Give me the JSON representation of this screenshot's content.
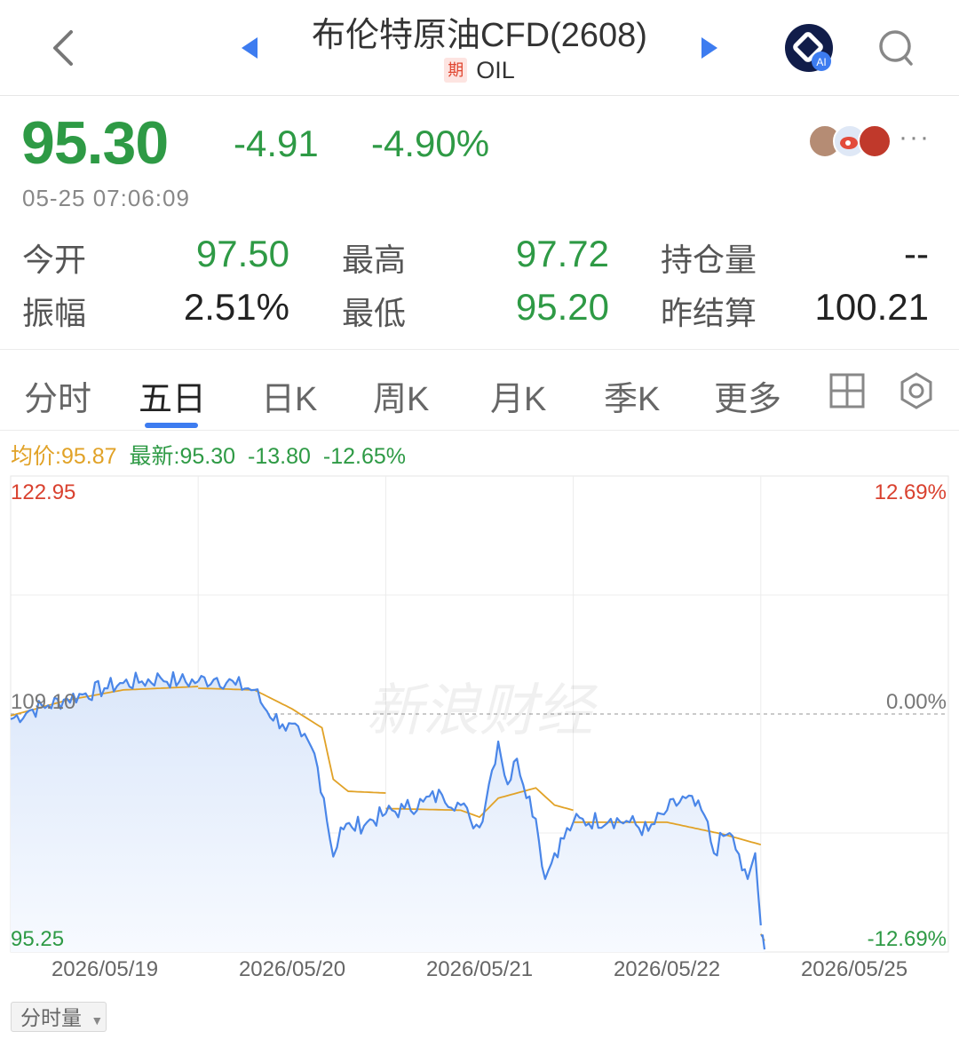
{
  "header": {
    "title": "布伦特原油CFD(2608)",
    "badge": "期",
    "symbol": "OIL"
  },
  "quote": {
    "last_price": "95.30",
    "change": "-4.91",
    "change_pct": "-4.90%",
    "timestamp": "05-25 07:06:09",
    "more": "···"
  },
  "stats": [
    {
      "label": "今开",
      "value": "97.50"
    },
    {
      "label": "最高",
      "value": "97.72"
    },
    {
      "label": "持仓量",
      "value": "--"
    },
    {
      "label": "振幅",
      "value": "2.51%"
    },
    {
      "label": "最低",
      "value": "95.20"
    },
    {
      "label": "昨结算",
      "value": "100.21"
    }
  ],
  "tabs": [
    "分时",
    "五日",
    "日K",
    "周K",
    "月K",
    "季K",
    "更多"
  ],
  "active_tab": "五日",
  "legend": {
    "avg": "均价:95.87",
    "latest": "最新:95.30",
    "change": "-13.80",
    "change_pct": "-12.65%"
  },
  "volume_button": "分时量",
  "colors": {
    "up": "#d9412f",
    "down": "#2e9a45",
    "accent": "#3d7cf0",
    "avg_line": "#e1a227",
    "price_line": "#4a86e8"
  },
  "chart_data": {
    "type": "line",
    "watermark": "新浪财经",
    "y_left_labels": [
      "122.95",
      "109.10",
      "95.25"
    ],
    "y_right_labels": [
      "12.69%",
      "0.00%",
      "-12.69%"
    ],
    "ylim": [
      95.25,
      122.95
    ],
    "baseline": 109.1,
    "x_labels": [
      "2026/05/19",
      "2026/05/20",
      "2026/05/21",
      "2026/05/22",
      "2026/05/25"
    ],
    "series": [
      {
        "role": "price",
        "days": [
          [
            [
              0,
              108.8
            ],
            [
              0.1,
              109.3
            ],
            [
              0.2,
              109.6
            ],
            [
              0.3,
              110.0
            ],
            [
              0.4,
              110.3
            ],
            [
              0.5,
              110.6
            ],
            [
              0.6,
              110.9
            ],
            [
              0.7,
              111.0
            ],
            [
              0.8,
              111.2
            ],
            [
              0.9,
              111.0
            ],
            [
              1.0,
              111.0
            ]
          ],
          [
            [
              0,
              111.0
            ],
            [
              0.1,
              111.2
            ],
            [
              0.2,
              110.8
            ],
            [
              0.3,
              110.5
            ],
            [
              0.35,
              109.5
            ],
            [
              0.45,
              108.5
            ],
            [
              0.55,
              107.8
            ],
            [
              0.62,
              106.8
            ],
            [
              0.67,
              104.2
            ],
            [
              0.72,
              100.8
            ],
            [
              0.76,
              102.5
            ],
            [
              0.82,
              102.5
            ],
            [
              0.9,
              102.8
            ],
            [
              1.0,
              103.3
            ]
          ],
          [
            [
              0,
              103.3
            ],
            [
              0.1,
              103.6
            ],
            [
              0.2,
              104.0
            ],
            [
              0.3,
              104.4
            ],
            [
              0.4,
              103.8
            ],
            [
              0.45,
              103.0
            ],
            [
              0.5,
              102.5
            ],
            [
              0.55,
              105.0
            ],
            [
              0.6,
              107.5
            ],
            [
              0.65,
              105.0
            ],
            [
              0.7,
              106.5
            ],
            [
              0.8,
              103.0
            ],
            [
              0.85,
              99.5
            ],
            [
              0.9,
              101.0
            ],
            [
              1.0,
              102.8
            ]
          ],
          [
            [
              0,
              102.8
            ],
            [
              0.2,
              103.0
            ],
            [
              0.3,
              102.8
            ],
            [
              0.4,
              102.3
            ],
            [
              0.5,
              103.5
            ],
            [
              0.6,
              104.2
            ],
            [
              0.7,
              103.2
            ],
            [
              0.75,
              101.0
            ],
            [
              0.8,
              102.0
            ],
            [
              0.85,
              102.0
            ],
            [
              0.9,
              100.0
            ],
            [
              0.93,
              99.5
            ],
            [
              0.97,
              101.0
            ],
            [
              1.0,
              96.8
            ]
          ],
          [
            [
              0,
              96.2
            ],
            [
              0.02,
              95.4
            ]
          ]
        ]
      },
      {
        "role": "average",
        "days": [
          [
            [
              0,
              109.0
            ],
            [
              0.3,
              109.9
            ],
            [
              0.6,
              110.5
            ],
            [
              1.0,
              110.7
            ]
          ],
          [
            [
              0,
              110.6
            ],
            [
              0.3,
              110.5
            ],
            [
              0.5,
              109.4
            ],
            [
              0.66,
              108.3
            ],
            [
              0.72,
              105.3
            ],
            [
              0.8,
              104.6
            ],
            [
              1.0,
              104.5
            ]
          ],
          [
            [
              0,
              103.6
            ],
            [
              0.4,
              103.5
            ],
            [
              0.5,
              103.1
            ],
            [
              0.6,
              104.2
            ],
            [
              0.8,
              104.8
            ],
            [
              0.9,
              103.8
            ],
            [
              1.0,
              103.5
            ]
          ],
          [
            [
              0,
              102.8
            ],
            [
              0.5,
              102.8
            ],
            [
              0.8,
              102.1
            ],
            [
              1.0,
              101.5
            ]
          ],
          [
            [
              0,
              96.3
            ],
            [
              0.02,
              95.9
            ]
          ]
        ]
      }
    ]
  }
}
